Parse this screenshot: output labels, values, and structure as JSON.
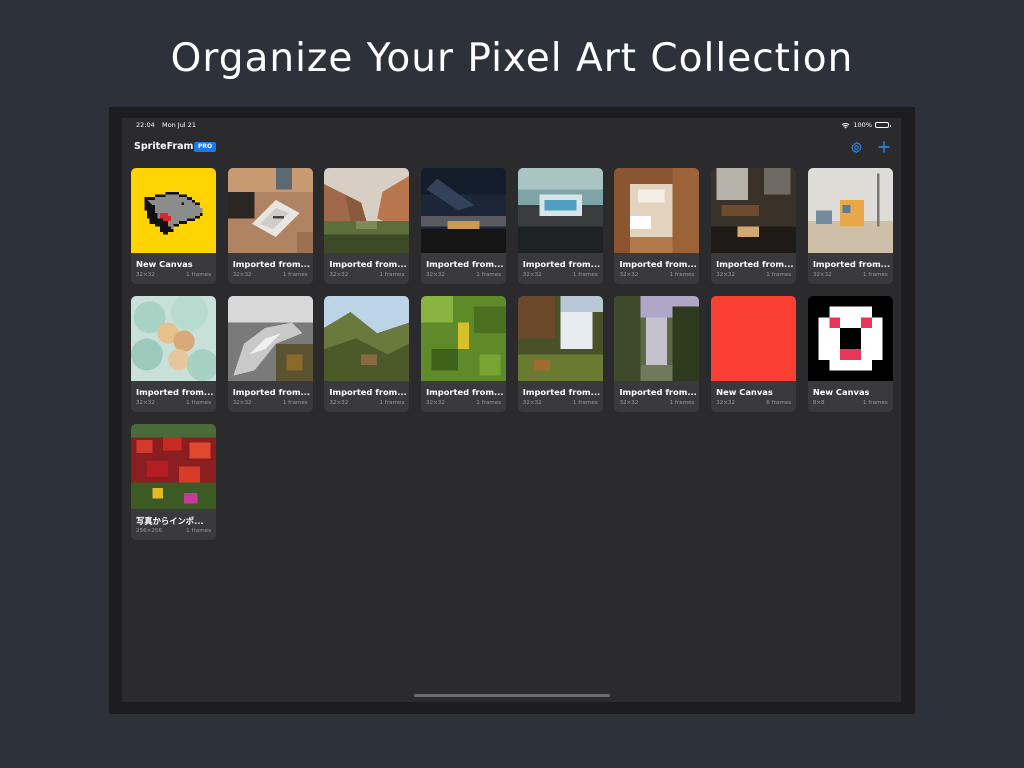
{
  "headline": "Organize Your Pixel Art Collection",
  "status": {
    "time": "22:04",
    "date": "Mon Jul 21",
    "battery": "100%"
  },
  "nav": {
    "app_title": "SpriteFrame",
    "badge": "PRO",
    "icons": [
      "gear-icon",
      "plus-icon"
    ],
    "accent": "#1a7be6"
  },
  "artworks": [
    {
      "name": "New Canvas",
      "size": "32×32",
      "frames": "1 frames",
      "thumb": "gray-creature-on-yellow"
    },
    {
      "name": "Imported from...",
      "size": "32×32",
      "frames": "1 frames",
      "thumb": "tablet-on-desk"
    },
    {
      "name": "Imported from...",
      "size": "32×32",
      "frames": "1 frames",
      "thumb": "canyon"
    },
    {
      "name": "Imported from...",
      "size": "32×32",
      "frames": "1 frames",
      "thumb": "night-sky"
    },
    {
      "name": "Imported from...",
      "size": "32×32",
      "frames": "1 frames",
      "thumb": "building"
    },
    {
      "name": "Imported from...",
      "size": "32×32",
      "frames": "1 frames",
      "thumb": "room-interior"
    },
    {
      "name": "Imported from...",
      "size": "32×32",
      "frames": "1 frames",
      "thumb": "dark-room"
    },
    {
      "name": "Imported from...",
      "size": "32×32",
      "frames": "1 frames",
      "thumb": "beach-hut"
    },
    {
      "name": "Imported from...",
      "size": "32×32",
      "frames": "1 frames",
      "thumb": "balloons"
    },
    {
      "name": "Imported from...",
      "size": "32×32",
      "frames": "1 frames",
      "thumb": "hand-bw"
    },
    {
      "name": "Imported from...",
      "size": "32×32",
      "frames": "1 frames",
      "thumb": "hillside"
    },
    {
      "name": "Imported from...",
      "size": "32×32",
      "frames": "1 frames",
      "thumb": "green-leaves"
    },
    {
      "name": "Imported from...",
      "size": "32×32",
      "frames": "1 frames",
      "thumb": "waterfall"
    },
    {
      "name": "Imported from...",
      "size": "32×32",
      "frames": "1 frames",
      "thumb": "misty-waterfall"
    },
    {
      "name": "New Canvas",
      "size": "32×32",
      "frames": "6 frames",
      "thumb": "solid-red"
    },
    {
      "name": "New Canvas",
      "size": "8×8",
      "frames": "1 frames",
      "thumb": "pixel-face"
    },
    {
      "name": "写真からインポ...",
      "size": "256×256",
      "frames": "1 frames",
      "thumb": "flowers"
    }
  ]
}
